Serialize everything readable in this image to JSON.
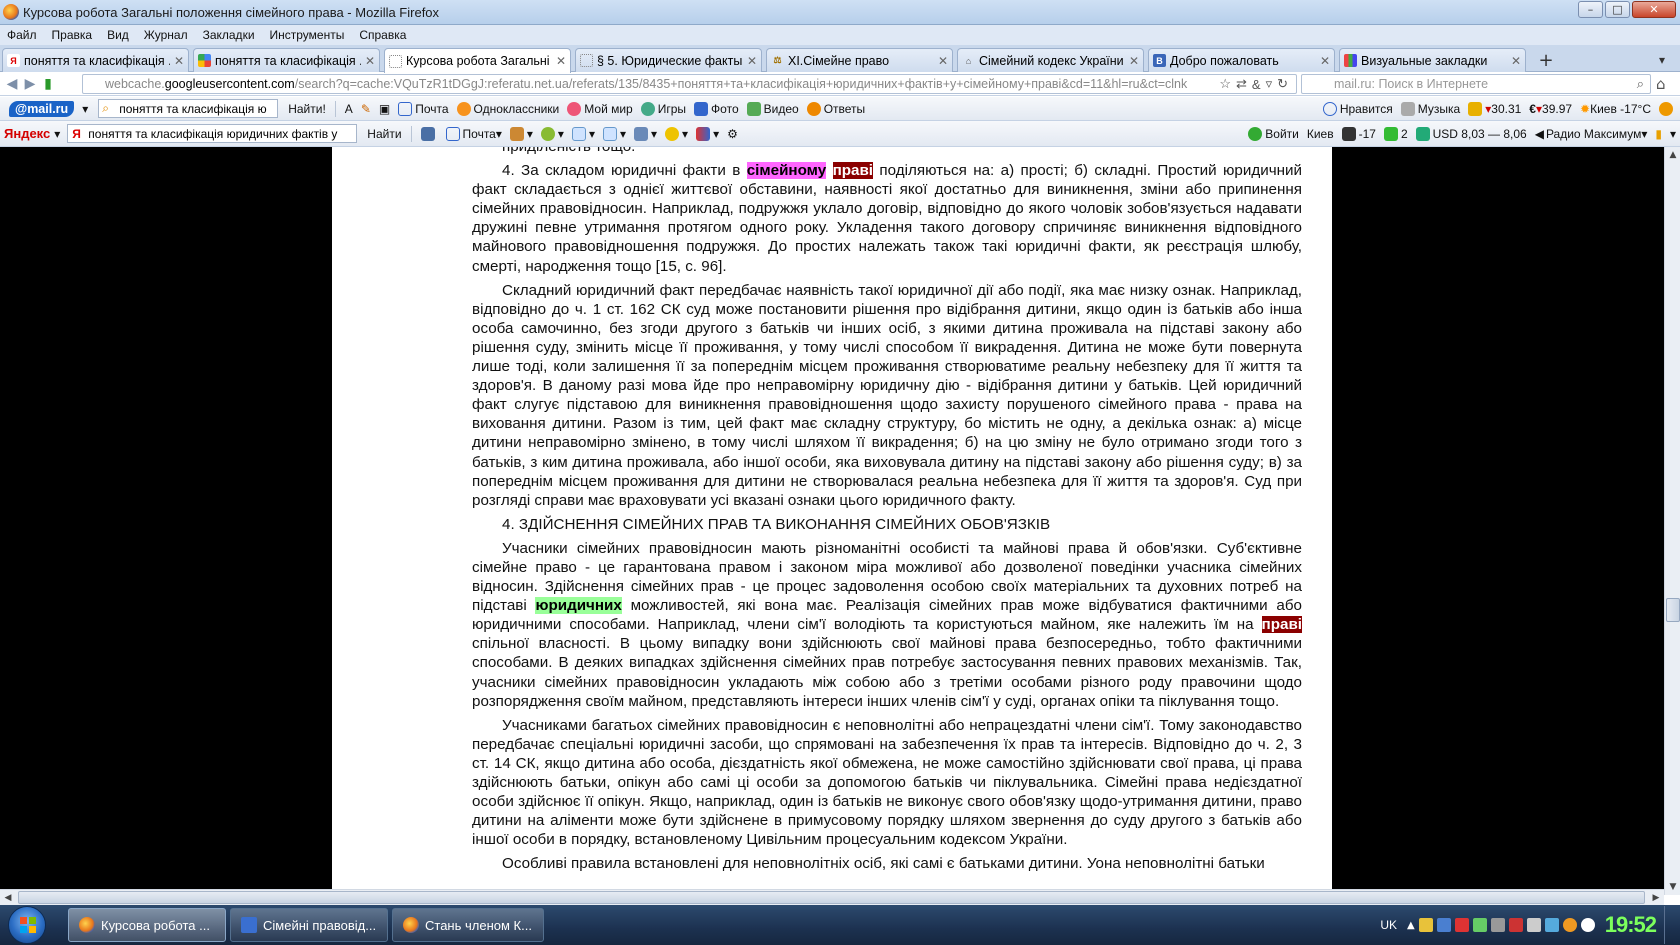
{
  "window": {
    "title": "Курсова робота Загальні положення сімейного права - Mozilla Firefox",
    "buttons": {
      "minimize": "–",
      "maximize": "□",
      "close": "✕"
    }
  },
  "menu": [
    "Файл",
    "Правка",
    "Вид",
    "Журнал",
    "Закладки",
    "Инструменты",
    "Справка"
  ],
  "tabs": [
    {
      "label": "поняття та класифікація ...",
      "icon": "yandex-icon",
      "active": false
    },
    {
      "label": "поняття та класифікація ...",
      "icon": "google-icon",
      "active": false
    },
    {
      "label": "Курсова робота Загальні п...",
      "icon": "page-icon",
      "active": true
    },
    {
      "label": "§ 5. Юридические факты ...",
      "icon": "page-icon",
      "active": false
    },
    {
      "label": "XI.Сімейне право",
      "icon": "scales-icon",
      "active": false
    },
    {
      "label": "Сімейний кодекс України | ...",
      "icon": "building-icon",
      "active": false
    },
    {
      "label": "Добро пожаловать",
      "icon": "b-icon",
      "active": false
    },
    {
      "label": "Визуальные закладки",
      "icon": "grid-icon",
      "active": false
    }
  ],
  "tab_close": "✕",
  "new_tab": "+",
  "nav": {
    "url_prefix": "webcache.",
    "url_host": "googleusercontent.com",
    "url_rest": "/search?q=cache:VQuTzR1tDGgJ:referatu.net.ua/referats/135/8435+поняття+та+класифікація+юридичних+фактів+у+сімейному+праві&cd=11&hl=ru&ct=clnk",
    "search_placeholder": "mail.ru: Поиск в Интернете"
  },
  "toolbar_mailru": {
    "logo": "@mail.ru",
    "search_value": "поняття та класифікація ю",
    "find_label": "Найти!",
    "items": [
      "Почта",
      "Одноклассники",
      "Мой мир",
      "Игры",
      "Фото",
      "Видео",
      "Ответы"
    ],
    "right_items": [
      "Нравится",
      "Музыка",
      "30.31",
      "39.97",
      "Киев -17°C"
    ]
  },
  "toolbar_yandex": {
    "logo": "Яндекс",
    "search_value": "поняття та класифікація юридичних фактів у",
    "find_label": "Найти",
    "mail_label": "Почта",
    "right_items": [
      "Войти",
      "Киев",
      "-17",
      "2",
      "USD 8,03 — 8,06",
      "Радио Максимум"
    ]
  },
  "document": {
    "top_cut": "приділеність тощо.",
    "p1": {
      "before": "4. За складом юридичні факти в ",
      "hl1": "сімейному",
      "mid": " ",
      "hl2": "праві",
      "after": " поділяються на: а) прості; б) складні. Простий юридичний факт складається з однієї життєвої обставини, наявності якої достатньо для виникнення, зміни або припинення сімейних правовідносин. Наприклад, подружжя уклало договір, відповідно до якого чоловік зобов'язується надавати дружині певне утримання протягом одного року. Укладення такого договору спричиняє виникнення відповідного майнового правовідношення подружжя. До простих належать також такі юридичні факти, як реєстрація шлюбу, смерті, народження тощо [15, с. 96]."
    },
    "p2": "Складний юридичний факт передбачає наявність такої юридичної дії або події, яка має низку ознак. Наприклад, відповідно до ч. 1 ст. 162 СК суд може постановити рішення про відібрання дитини, якщо один із батьків або інша особа самочинно, без згоди другого з батьків чи інших осіб, з якими дитина проживала на підставі закону або рішення суду, змінить місце її проживання, у тому числі способом її викрадення. Дитина не може бути повернута лише тоді, коли залишення її за попереднім місцем проживання створюватиме реальну небезпеку для її життя та здоров'я. В даному разі мова йде про неправомірну юридичну дію - відібрання дитини у батьків. Цей юридичний факт слугує підставою для виникнення правовідношення щодо захисту порушеного сімейного права - права на виховання дитини. Разом із тим, цей факт має складну структуру, бо містить не одну, а декілька ознак: а) місце дитини неправомірно змінено, в тому числі шляхом її викрадення; б) на цю зміну не було отримано згоди того з батьків, з ким дитина проживала, або іншої особи, яка виховувала дитину на підставі закону або рішення суду; в) за попереднім місцем проживання для дитини не створювалася реальна небезпека для її життя та здоров'я. Суд при розгляді справи має враховувати усі вказані ознаки цього юридичного факту.",
    "heading": "4. ЗДІЙСНЕННЯ СІМЕЙНИХ ПРАВ ТА ВИКОНАННЯ СІМЕЙНИХ ОБОВ'ЯЗКІВ",
    "p3": {
      "a": "Учасники сімейних правовідносин мають різноманітні особисті та майнові права й обов'язки. Суб'єктивне сімейне право - це гарантована правом і законом міра можливої або дозволеної поведінки учасника сімейних відносин. Здійснення сімейних прав - це процес задоволення особою своїх матеріальних та духовних потреб на підставі ",
      "hl_green": "юридичних",
      "b": " можливостей, які вона має. Реалізація сімейних прав може відбуватися фактичними або юридичними способами. Наприклад, члени сім'ї володіють та користуються майном, яке належить їм на ",
      "hl_red": "праві",
      "c": " спільної власності. В цьому випадку вони здійснюють свої майнові права безпосередньо, тобто фактичними способами. В деяких випадках здійснення сімейних прав потребує застосування певних правових механізмів. Так, учасники сімейних правовідносин укладають між собою або з третіми особами різного роду правочини щодо розпорядження своїм майном, представляють інтереси інших членів сім'ї у суді, органах опіки та піклування тощо."
    },
    "p4": "Учасниками багатьох сімейних правовідносин є неповнолітні або непрацездатні члени сім'ї. Тому законодавство передбачає спеціальні юридичні засоби, що спрямовані на забезпечення їх прав та інтересів. Відповідно до ч. 2, 3 ст. 14 СК, якщо дитина або особа, дієздатність якої обмежена, не може самостійно здійснювати свої права, ці права здійснюють батьки, опікун або самі ці особи за допомогою батьків чи піклувальника. Сімейні права недієздатної особи здійснює її опікун. Якщо, наприклад, один із батьків не виконує свого обов'язку щодо-утримання дитини, право дитини на аліменти може бути здійснене в примусовому порядку шляхом звернення до суду другого з батьків або іншої особи в порядку, встановленому Цивільним процесуальним кодексом України.",
    "p5_cut": "Особливі правила встановлені для неповнолітніх осіб, які самі є батьками дитини. Уона неповнолітні батьки"
  },
  "taskbar": {
    "tasks": [
      {
        "label": "Курсова робота ...",
        "active": true
      },
      {
        "label": "Сімейні правовід...",
        "active": false
      },
      {
        "label": "Стань членом К...",
        "active": false
      }
    ],
    "lang": "UK",
    "clock": "19:52"
  },
  "colors": {
    "highlight_pink": "#ff66ff",
    "highlight_red": "#8b0000",
    "highlight_green": "#99ff99"
  }
}
